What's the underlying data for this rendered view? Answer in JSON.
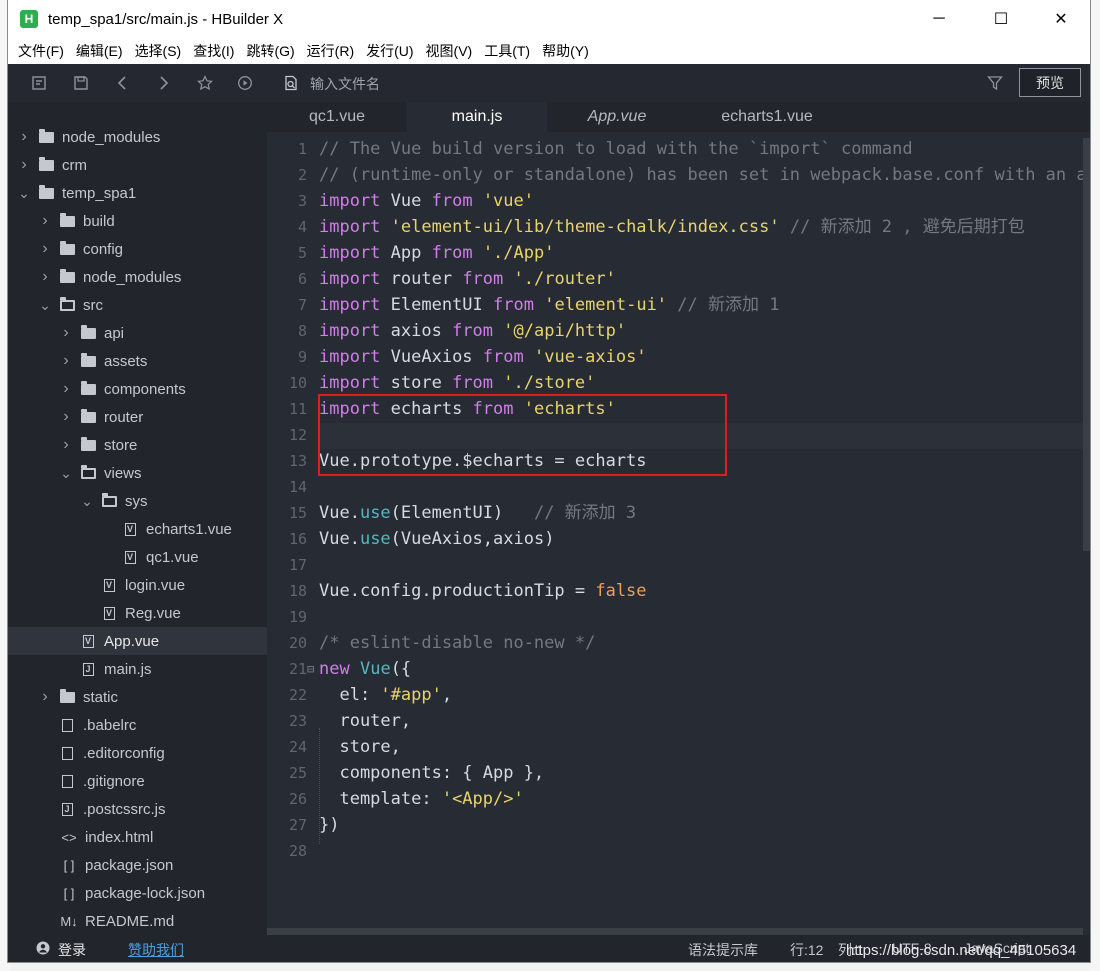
{
  "window": {
    "title": "temp_spa1/src/main.js - HBuilder X",
    "logo_glyph": "H",
    "controls": {
      "minimize": "─",
      "maximize": "☐",
      "close": "✕"
    }
  },
  "menu": [
    "文件(F)",
    "编辑(E)",
    "选择(S)",
    "查找(I)",
    "跳转(G)",
    "运行(R)",
    "发行(U)",
    "视图(V)",
    "工具(T)",
    "帮助(Y)"
  ],
  "toolbar": {
    "icons": [
      "new-file-icon",
      "save-icon",
      "back-icon",
      "forward-icon",
      "star-icon",
      "run-icon",
      "file-search-icon",
      "filter-icon"
    ],
    "file_search_placeholder": "输入文件名",
    "preview_label": "预览"
  },
  "tabs": [
    {
      "label": "qc1.vue",
      "active": false,
      "italic": false
    },
    {
      "label": "main.js",
      "active": true,
      "italic": false
    },
    {
      "label": "App.vue",
      "active": false,
      "italic": true
    },
    {
      "label": "echarts1.vue",
      "active": false,
      "italic": false
    }
  ],
  "tree": [
    {
      "label": "node_modules",
      "type": "folder",
      "depth": 0,
      "expanded": false
    },
    {
      "label": "crm",
      "type": "folder",
      "depth": 0,
      "expanded": false
    },
    {
      "label": "temp_spa1",
      "type": "folder",
      "depth": 0,
      "expanded": true
    },
    {
      "label": "build",
      "type": "folder",
      "depth": 1,
      "expanded": false
    },
    {
      "label": "config",
      "type": "folder",
      "depth": 1,
      "expanded": false
    },
    {
      "label": "node_modules",
      "type": "folder",
      "depth": 1,
      "expanded": false
    },
    {
      "label": "src",
      "type": "folder-open",
      "depth": 1,
      "expanded": true
    },
    {
      "label": "api",
      "type": "folder",
      "depth": 2,
      "expanded": false
    },
    {
      "label": "assets",
      "type": "folder",
      "depth": 2,
      "expanded": false
    },
    {
      "label": "components",
      "type": "folder",
      "depth": 2,
      "expanded": false
    },
    {
      "label": "router",
      "type": "folder",
      "depth": 2,
      "expanded": false
    },
    {
      "label": "store",
      "type": "folder",
      "depth": 2,
      "expanded": false
    },
    {
      "label": "views",
      "type": "folder-open",
      "depth": 2,
      "expanded": true
    },
    {
      "label": "sys",
      "type": "folder-open",
      "depth": 3,
      "expanded": true
    },
    {
      "label": "echarts1.vue",
      "type": "vue",
      "depth": 4
    },
    {
      "label": "qc1.vue",
      "type": "vue",
      "depth": 4
    },
    {
      "label": "login.vue",
      "type": "vue",
      "depth": 3
    },
    {
      "label": "Reg.vue",
      "type": "vue",
      "depth": 3
    },
    {
      "label": "App.vue",
      "type": "vue",
      "depth": 2,
      "selected": true
    },
    {
      "label": "main.js",
      "type": "js",
      "depth": 2
    },
    {
      "label": "static",
      "type": "folder",
      "depth": 1,
      "expanded": false
    },
    {
      "label": ".babelrc",
      "type": "file",
      "depth": 1
    },
    {
      "label": ".editorconfig",
      "type": "file",
      "depth": 1
    },
    {
      "label": ".gitignore",
      "type": "file",
      "depth": 1
    },
    {
      "label": ".postcssrc.js",
      "type": "js",
      "depth": 1
    },
    {
      "label": "index.html",
      "type": "html",
      "depth": 1
    },
    {
      "label": "package.json",
      "type": "json",
      "depth": 1
    },
    {
      "label": "package-lock.json",
      "type": "json",
      "depth": 1
    },
    {
      "label": "README.md",
      "type": "md",
      "depth": 1
    }
  ],
  "code": [
    [
      [
        "com",
        "// The Vue build version to load with the `import` command"
      ]
    ],
    [
      [
        "com",
        "// (runtime-only or standalone) has been set in webpack.base.conf with an alias."
      ]
    ],
    [
      [
        "kw",
        "import"
      ],
      [
        "txt",
        " Vue "
      ],
      [
        "kw",
        "from"
      ],
      [
        "txt",
        " "
      ],
      [
        "str",
        "'vue'"
      ]
    ],
    [
      [
        "kw",
        "import"
      ],
      [
        "txt",
        " "
      ],
      [
        "str",
        "'element-ui/lib/theme-chalk/index.css'"
      ],
      [
        "txt",
        " "
      ],
      [
        "com",
        "// 新添加 2 , 避免后期打包"
      ]
    ],
    [
      [
        "kw",
        "import"
      ],
      [
        "txt",
        " App "
      ],
      [
        "kw",
        "from"
      ],
      [
        "txt",
        " "
      ],
      [
        "str",
        "'./App'"
      ]
    ],
    [
      [
        "kw",
        "import"
      ],
      [
        "txt",
        " router "
      ],
      [
        "kw",
        "from"
      ],
      [
        "txt",
        " "
      ],
      [
        "str",
        "'./router'"
      ]
    ],
    [
      [
        "kw",
        "import"
      ],
      [
        "txt",
        " ElementUI "
      ],
      [
        "kw",
        "from"
      ],
      [
        "txt",
        " "
      ],
      [
        "str",
        "'element-ui'"
      ],
      [
        "txt",
        " "
      ],
      [
        "com",
        "// 新添加 1"
      ]
    ],
    [
      [
        "kw",
        "import"
      ],
      [
        "txt",
        " axios "
      ],
      [
        "kw",
        "from"
      ],
      [
        "txt",
        " "
      ],
      [
        "str",
        "'@/api/http'"
      ]
    ],
    [
      [
        "kw",
        "import"
      ],
      [
        "txt",
        " VueAxios "
      ],
      [
        "kw",
        "from"
      ],
      [
        "txt",
        " "
      ],
      [
        "str",
        "'vue-axios'"
      ]
    ],
    [
      [
        "kw",
        "import"
      ],
      [
        "txt",
        " store "
      ],
      [
        "kw",
        "from"
      ],
      [
        "txt",
        " "
      ],
      [
        "str",
        "'./store'"
      ]
    ],
    [
      [
        "kw",
        "import"
      ],
      [
        "txt",
        " echarts "
      ],
      [
        "kw",
        "from"
      ],
      [
        "txt",
        " "
      ],
      [
        "str",
        "'echarts'"
      ]
    ],
    [],
    [
      [
        "txt",
        "Vue.prototype.$echarts = echarts"
      ]
    ],
    [],
    [
      [
        "txt",
        "Vue."
      ],
      [
        "fn",
        "use"
      ],
      [
        "txt",
        "(ElementUI)   "
      ],
      [
        "com",
        "// 新添加 3"
      ]
    ],
    [
      [
        "txt",
        "Vue."
      ],
      [
        "fn",
        "use"
      ],
      [
        "txt",
        "(VueAxios,axios)"
      ]
    ],
    [],
    [
      [
        "txt",
        "Vue.config.productionTip = "
      ],
      [
        "bool",
        "false"
      ]
    ],
    [],
    [
      [
        "com",
        "/* eslint-disable no-new */"
      ]
    ],
    [
      [
        "kw",
        "new"
      ],
      [
        "txt",
        " "
      ],
      [
        "fn",
        "Vue"
      ],
      [
        "txt",
        "({"
      ]
    ],
    [
      [
        "txt",
        "  el: "
      ],
      [
        "str",
        "'#app'"
      ],
      [
        "txt",
        ","
      ]
    ],
    [
      [
        "txt",
        "  router,"
      ]
    ],
    [
      [
        "txt",
        "  store,"
      ]
    ],
    [
      [
        "txt",
        "  components: { App },"
      ]
    ],
    [
      [
        "txt",
        "  template: "
      ],
      [
        "str",
        "'<App/>'"
      ]
    ],
    [
      [
        "txt",
        "})"
      ]
    ],
    []
  ],
  "status": {
    "login": "登录",
    "sponsor": "赞助我们",
    "syntax_lib": "语法提示库",
    "line": "行:12",
    "col": "列:1",
    "url_watermark": "https://blog.csdn.net/qq_45105634",
    "encoding": "UTF-8",
    "lang": "JavaScript"
  },
  "colors": {
    "highlight_box": "#e8191e",
    "keyword": "#d07ee9",
    "string": "#e8d36c",
    "comment": "#727982",
    "function": "#56b6c2"
  }
}
